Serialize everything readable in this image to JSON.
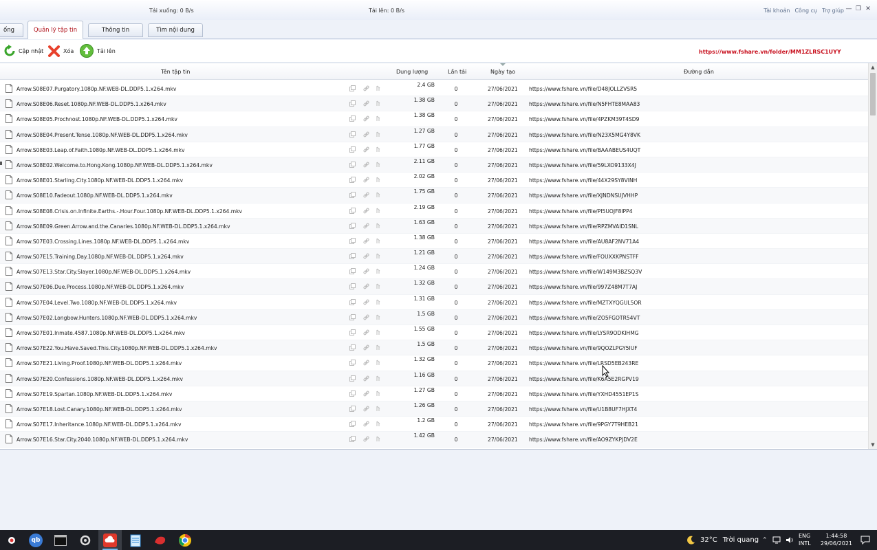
{
  "titlebar": {
    "download_speed": "Tải xuống: 0 B/s",
    "upload_speed": "Tải lên: 0 B/s",
    "menu": [
      "Tài khoản",
      "Công cụ",
      "Trợ giúp"
    ],
    "minimize": "—",
    "restore": "❐",
    "close": "✕"
  },
  "tabs": [
    "ống",
    "Quản lý tập tin",
    "Thông tin",
    "Tìm nội dung"
  ],
  "toolbar": {
    "refresh_label": "Cập nhật",
    "delete_label": "Xóa",
    "upload_label": "Tải lên",
    "folder_url": "https://www.fshare.vn/folder/MM1ZLRSC1UYY"
  },
  "table": {
    "headers": {
      "name": "Tên tập tin",
      "size": "Dung lượng",
      "downloads": "Lần tải",
      "date": "Ngày tạo",
      "link": "Đường dẫn"
    },
    "rows": [
      {
        "name": "Arrow.S08E07.Purgatory.1080p.NF.WEB-DL.DDP5.1.x264.mkv",
        "size": "2.4 GB",
        "downloads": "0",
        "date": "27/06/2021",
        "link": "https://www.fshare.vn/file/D48JOLLZVSR5"
      },
      {
        "name": "Arrow.S08E06.Reset.1080p.NF.WEB-DL.DDP5.1.x264.mkv",
        "size": "1.38 GB",
        "downloads": "0",
        "date": "27/06/2021",
        "link": "https://www.fshare.vn/file/N5FHTE8MAA83"
      },
      {
        "name": "Arrow.S08E05.Prochnost.1080p.NF.WEB-DL.DDP5.1.x264.mkv",
        "size": "1.38 GB",
        "downloads": "0",
        "date": "27/06/2021",
        "link": "https://www.fshare.vn/file/4PZKM39T4SD9"
      },
      {
        "name": "Arrow.S08E04.Present.Tense.1080p.NF.WEB-DL.DDP5.1.x264.mkv",
        "size": "1.27 GB",
        "downloads": "0",
        "date": "27/06/2021",
        "link": "https://www.fshare.vn/file/N23X5MG4Y8VK"
      },
      {
        "name": "Arrow.S08E03.Leap.of.Faith.1080p.NF.WEB-DL.DDP5.1.x264.mkv",
        "size": "1.77 GB",
        "downloads": "0",
        "date": "27/06/2021",
        "link": "https://www.fshare.vn/file/BAAABEUS4UQT"
      },
      {
        "name": "Arrow.S08E02.Welcome.to.Hong.Kong.1080p.NF.WEB-DL.DDP5.1.x264.mkv",
        "size": "2.11 GB",
        "downloads": "0",
        "date": "27/06/2021",
        "link": "https://www.fshare.vn/file/59LXO9133X4J"
      },
      {
        "name": "Arrow.S08E01.Starling.City.1080p.NF.WEB-DL.DDP5.1.x264.mkv",
        "size": "2.02 GB",
        "downloads": "0",
        "date": "27/06/2021",
        "link": "https://www.fshare.vn/file/44X29SY8VINH"
      },
      {
        "name": "Arrow.S08E10.Fadeout.1080p.NF.WEB-DL.DDP5.1.x264.mkv",
        "size": "1.75 GB",
        "downloads": "0",
        "date": "27/06/2021",
        "link": "https://www.fshare.vn/file/XJNDNSUJVHHP"
      },
      {
        "name": "Arrow.S08E08.Crisis.on.Infinite.Earths.-.Hour.Four.1080p.NF.WEB-DL.DDP5.1.x264.mkv",
        "size": "2.19 GB",
        "downloads": "0",
        "date": "27/06/2021",
        "link": "https://www.fshare.vn/file/PI5UOJF8IPP4"
      },
      {
        "name": "Arrow.S08E09.Green.Arrow.and.the.Canaries.1080p.NF.WEB-DL.DDP5.1.x264.mkv",
        "size": "1.63 GB",
        "downloads": "0",
        "date": "27/06/2021",
        "link": "https://www.fshare.vn/file/RPZMVAID1SNL"
      },
      {
        "name": "Arrow.S07E03.Crossing.Lines.1080p.NF.WEB-DL.DDP5.1.x264.mkv",
        "size": "1.38 GB",
        "downloads": "0",
        "date": "27/06/2021",
        "link": "https://www.fshare.vn/file/AU8AF2NV71A4"
      },
      {
        "name": "Arrow.S07E15.Training.Day.1080p.NF.WEB-DL.DDP5.1.x264.mkv",
        "size": "1.21 GB",
        "downloads": "0",
        "date": "27/06/2021",
        "link": "https://www.fshare.vn/file/FOUXXKPNSTFF"
      },
      {
        "name": "Arrow.S07E13.Star.City.Slayer.1080p.NF.WEB-DL.DDP5.1.x264.mkv",
        "size": "1.24 GB",
        "downloads": "0",
        "date": "27/06/2021",
        "link": "https://www.fshare.vn/file/W149M3BZSQ3V"
      },
      {
        "name": "Arrow.S07E06.Due.Process.1080p.NF.WEB-DL.DDP5.1.x264.mkv",
        "size": "1.32 GB",
        "downloads": "0",
        "date": "27/06/2021",
        "link": "https://www.fshare.vn/file/997Z48M7T7AJ"
      },
      {
        "name": "Arrow.S07E04.Level.Two.1080p.NF.WEB-DL.DDP5.1.x264.mkv",
        "size": "1.31 GB",
        "downloads": "0",
        "date": "27/06/2021",
        "link": "https://www.fshare.vn/file/MZTXYQGUL5OR"
      },
      {
        "name": "Arrow.S07E02.Longbow.Hunters.1080p.NF.WEB-DL.DDP5.1.x264.mkv",
        "size": "1.5 GB",
        "downloads": "0",
        "date": "27/06/2021",
        "link": "https://www.fshare.vn/file/ZO5FGOTR54VT"
      },
      {
        "name": "Arrow.S07E01.Inmate.4587.1080p.NF.WEB-DL.DDP5.1.x264.mkv",
        "size": "1.55 GB",
        "downloads": "0",
        "date": "27/06/2021",
        "link": "https://www.fshare.vn/file/LYSR9ODKIHMG"
      },
      {
        "name": "Arrow.S07E22.You.Have.Saved.This.City.1080p.NF.WEB-DL.DDP5.1.x264.mkv",
        "size": "1.5 GB",
        "downloads": "0",
        "date": "27/06/2021",
        "link": "https://www.fshare.vn/file/9QOZLPGY5IUF"
      },
      {
        "name": "Arrow.S07E21.Living.Proof.1080p.NF.WEB-DL.DDP5.1.x264.mkv",
        "size": "1.32 GB",
        "downloads": "0",
        "date": "27/06/2021",
        "link": "https://www.fshare.vn/file/LRSD5EB243RE"
      },
      {
        "name": "Arrow.S07E20.Confessions.1080p.NF.WEB-DL.DDP5.1.x264.mkv",
        "size": "1.16 GB",
        "downloads": "0",
        "date": "27/06/2021",
        "link": "https://www.fshare.vn/file/K6A5E2RGPV19"
      },
      {
        "name": "Arrow.S07E19.Spartan.1080p.NF.WEB-DL.DDP5.1.x264.mkv",
        "size": "1.27 GB",
        "downloads": "0",
        "date": "27/06/2021",
        "link": "https://www.fshare.vn/file/YXHD4551EP1S"
      },
      {
        "name": "Arrow.S07E18.Lost.Canary.1080p.NF.WEB-DL.DDP5.1.x264.mkv",
        "size": "1.26 GB",
        "downloads": "0",
        "date": "27/06/2021",
        "link": "https://www.fshare.vn/file/U1B8UF7HJXT4"
      },
      {
        "name": "Arrow.S07E17.Inheritance.1080p.NF.WEB-DL.DDP5.1.x264.mkv",
        "size": "1.2 GB",
        "downloads": "0",
        "date": "27/06/2021",
        "link": "https://www.fshare.vn/file/9PGY7T9HEB21"
      },
      {
        "name": "Arrow.S07E16.Star.City.2040.1080p.NF.WEB-DL.DDP5.1.x264.mkv",
        "size": "1.42 GB",
        "downloads": "0",
        "date": "27/06/2021",
        "link": "https://www.fshare.vn/file/AO9ZYKPJDV2E"
      }
    ]
  },
  "taskbar": {
    "apps": [
      "start-icon",
      "qbittorrent-icon",
      "terminal-icon",
      "settings-icon",
      "fshare-icon",
      "notepad-icon",
      "app-red-icon",
      "chrome-icon"
    ],
    "qb_label": "qb",
    "weather_temp": "32°C",
    "weather_text": "Trời quang",
    "lang1": "ENG",
    "lang2": "INTL",
    "time": "1:44:58",
    "date": "29/06/2021"
  },
  "colors": {
    "accent_red": "#c8101e",
    "tab_active_text": "#b0121b",
    "taskbar_bg": "#1c1e24"
  }
}
